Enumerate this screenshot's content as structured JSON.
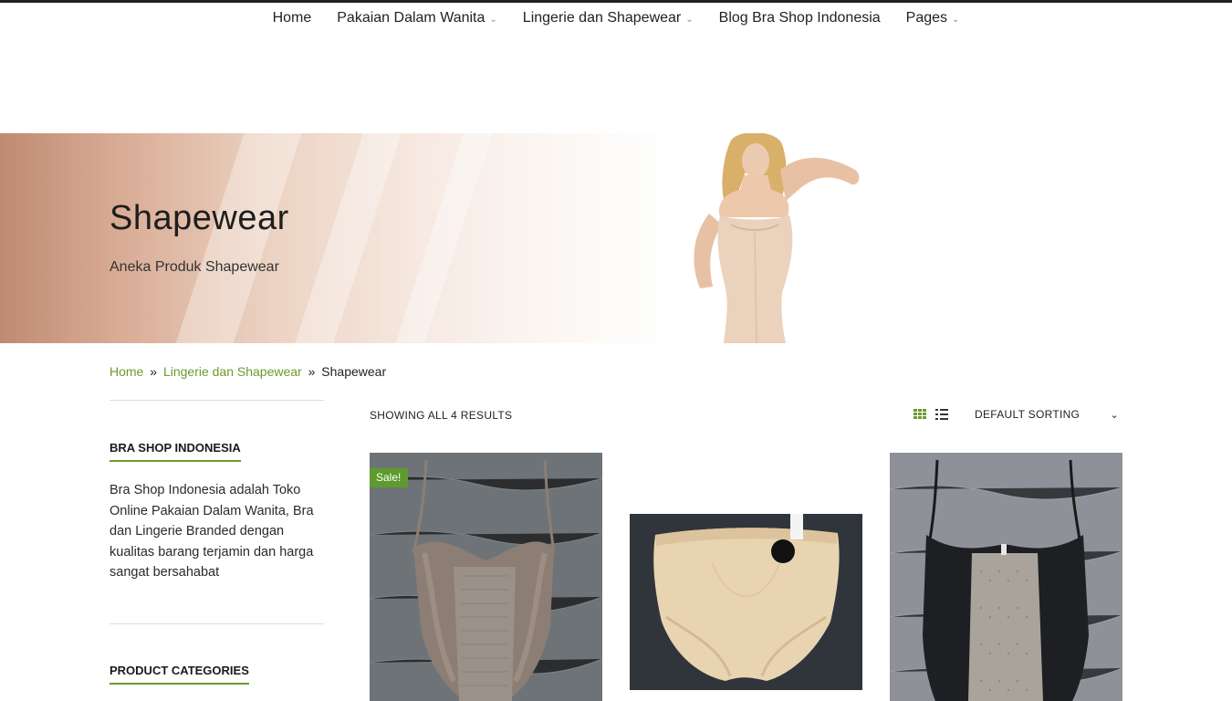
{
  "nav": {
    "items": [
      {
        "label": "Home",
        "has_dropdown": false
      },
      {
        "label": "Pakaian Dalam Wanita",
        "has_dropdown": true
      },
      {
        "label": "Lingerie dan Shapewear",
        "has_dropdown": true
      },
      {
        "label": "Blog Bra Shop Indonesia",
        "has_dropdown": false
      },
      {
        "label": "Pages",
        "has_dropdown": true
      }
    ],
    "dropdown_icon": "chevron-down-icon"
  },
  "hero": {
    "title": "Shapewear",
    "subtitle": "Aneka Produk Shapewear"
  },
  "breadcrumb": {
    "items": [
      "Home",
      "Lingerie dan Shapewear",
      "Shapewear"
    ],
    "separator": "»"
  },
  "sidebar": {
    "widget1_title": "BRA SHOP INDONESIA",
    "widget1_text": "Bra Shop Indonesia adalah Toko Online Pakaian Dalam Wanita, Bra dan Lingerie Branded dengan kualitas barang terjamin dan harga sangat bersahabat",
    "widget2_title": "PRODUCT CATEGORIES"
  },
  "shop": {
    "results_text": "SHOWING ALL 4 RESULTS",
    "sorting_label": "DEFAULT SORTING",
    "grid_icon": "grid-view-icon",
    "list_icon": "list-view-icon"
  },
  "products": [
    {
      "badge": "Sale!"
    },
    {
      "badge": ""
    },
    {
      "badge": ""
    }
  ],
  "colors": {
    "accent": "#6a9b2e",
    "sale_badge": "#5e9a2d",
    "text": "#222222"
  }
}
